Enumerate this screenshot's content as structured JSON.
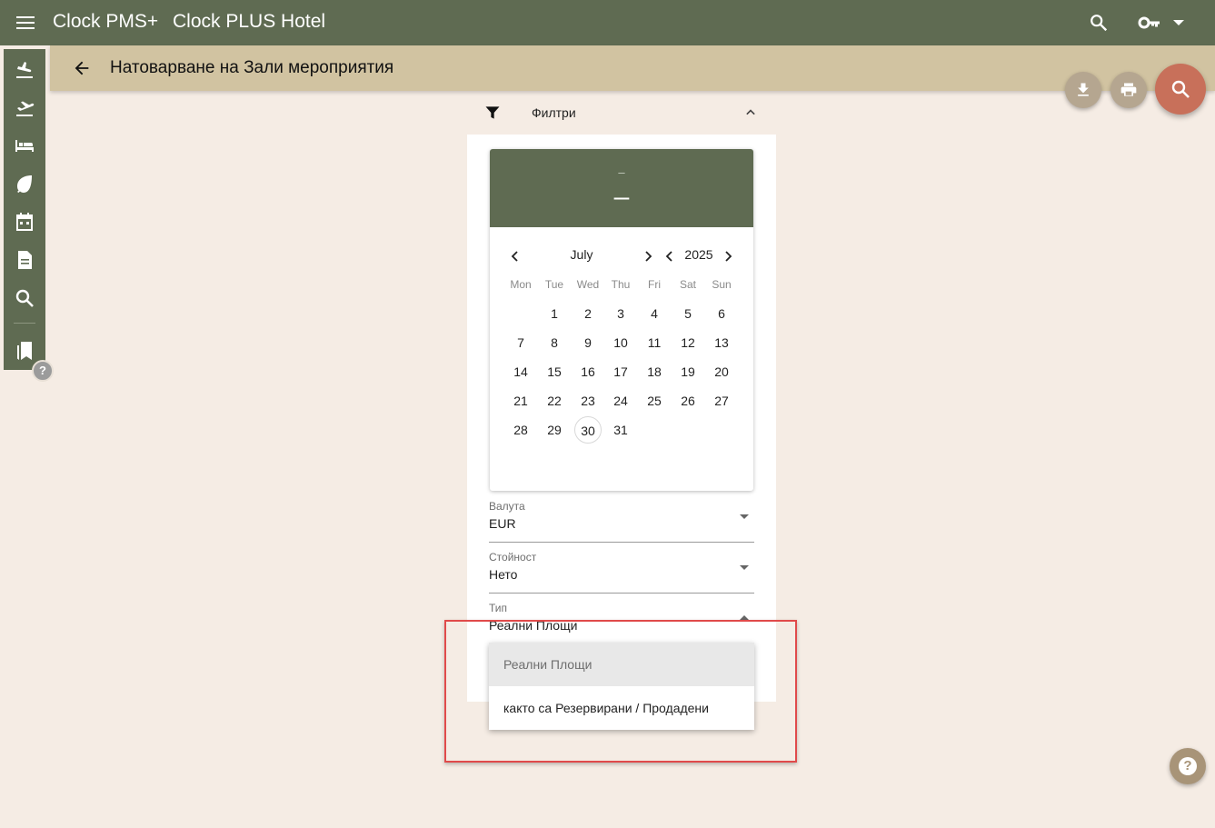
{
  "app": {
    "title": "Clock PMS+",
    "hotel": "Clock PLUS Hotel"
  },
  "page": {
    "title": "Натоварване на Зали мероприятия"
  },
  "filters": {
    "title": "Филтри"
  },
  "calendar": {
    "year_display": "–",
    "date_display": "–",
    "month": "July",
    "year": "2025",
    "weekdays": [
      "Mon",
      "Tue",
      "Wed",
      "Thu",
      "Fri",
      "Sat",
      "Sun"
    ],
    "first_weekday_index": 1,
    "days_in_month": 31,
    "today": 30
  },
  "fields": {
    "currency": {
      "label": "Валута",
      "value": "EUR"
    },
    "value_type": {
      "label": "Стойност",
      "value": "Нето"
    },
    "type": {
      "label": "Тип",
      "value": "Реални Площи"
    }
  },
  "dropdown": {
    "options": [
      "Реални Площи",
      "както са Резервирани / Продадени"
    ],
    "selected_index": 0
  },
  "help": {
    "rail_label": "?",
    "fab_label": "?"
  },
  "colors": {
    "primary": "#5f6b52",
    "header": "#d1c3a1",
    "background": "#f5ece4",
    "accent": "#c8705a",
    "highlight": "#e04a4a"
  }
}
